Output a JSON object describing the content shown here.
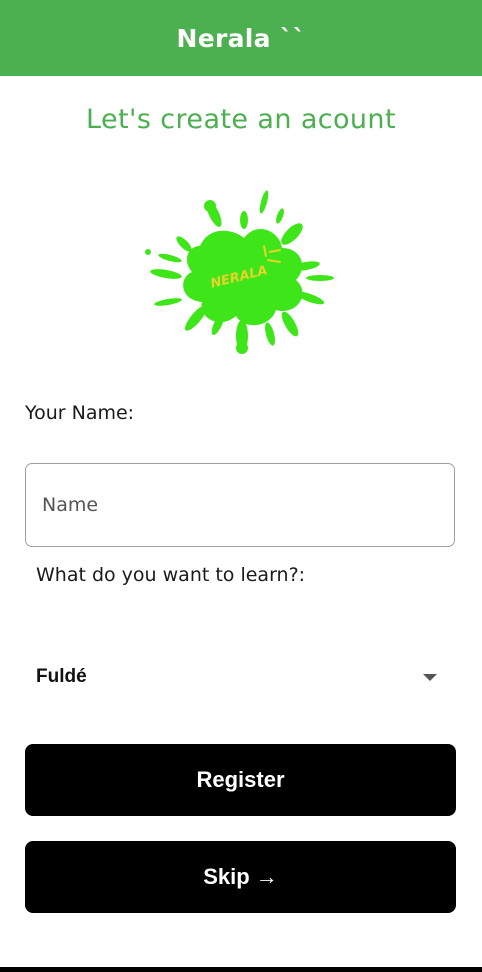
{
  "appbar": {
    "title": "Nerala ``"
  },
  "page": {
    "title": "Let's create an acount"
  },
  "logo": {
    "text": "NERALA",
    "splash_color": "#3ee619",
    "text_color": "#e8d32a"
  },
  "form": {
    "name_label": "Your Name:",
    "name_placeholder": "Name",
    "name_value": "",
    "learn_label": "What do you want to learn?:",
    "learn_selected": "Fuldé"
  },
  "buttons": {
    "register_label": "Register",
    "skip_label": "Skip →"
  },
  "colors": {
    "accent": "#4caf50",
    "button": "#000000"
  }
}
